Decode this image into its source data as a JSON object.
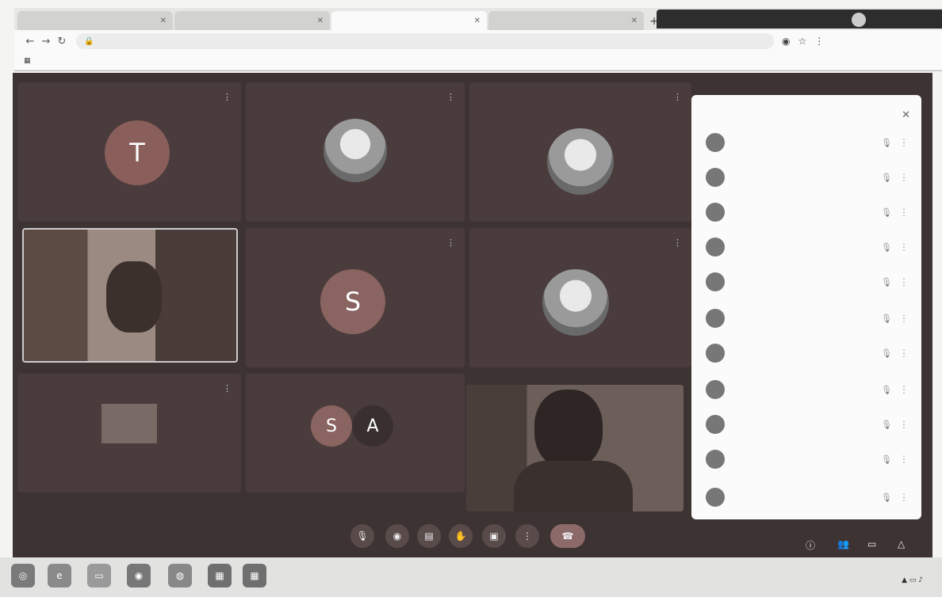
{
  "browser": {
    "tabs": [
      {
        "label": ""
      },
      {
        "label": ""
      },
      {
        "label": ""
      },
      {
        "label": ""
      }
    ],
    "address": "",
    "bookmarks": []
  },
  "meet": {
    "tiles": [
      {
        "name": "",
        "initial": "T",
        "kind": "letter",
        "color": "#8a5f5b"
      },
      {
        "name": "",
        "initial": "",
        "kind": "photo"
      },
      {
        "name": "",
        "initial": "",
        "kind": "photo"
      },
      {
        "name": "",
        "initial": "",
        "kind": "video"
      },
      {
        "name": "",
        "initial": "S",
        "kind": "letter",
        "color": "#8a6460"
      },
      {
        "name": "",
        "initial": "",
        "kind": "photo"
      },
      {
        "name": "",
        "initial": "",
        "kind": "image"
      },
      {
        "name": "",
        "initial": "",
        "kind": "group",
        "initials": [
          "S",
          "A"
        ]
      },
      {
        "name": "",
        "initial": "",
        "kind": "video"
      }
    ],
    "participants_panel": {
      "title": "",
      "rows": [
        "",
        "",
        "",
        "",
        "",
        "",
        "",
        "",
        "",
        "",
        ""
      ]
    },
    "clock": ""
  },
  "colors": {
    "meeting_bg": "#3e3333",
    "tile_bg": "#4a3c3c",
    "panel_bg": "#fbfbfb"
  }
}
